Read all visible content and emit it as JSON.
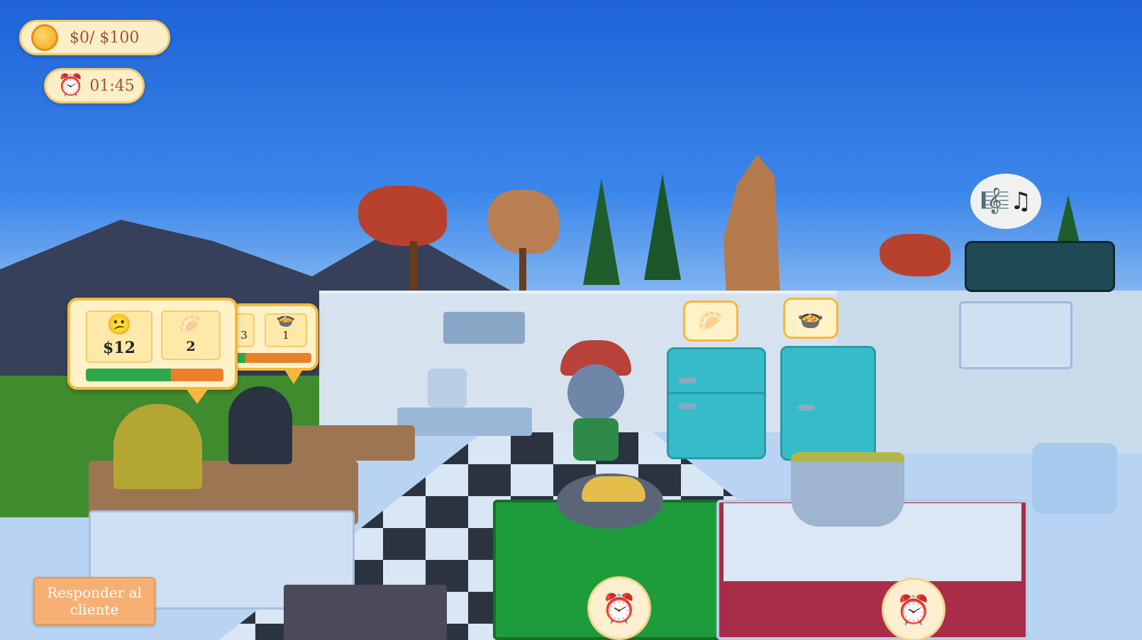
{
  "hud": {
    "money_label": "$0/ $100",
    "timer_label": "01:45"
  },
  "orders": {
    "front": {
      "tip_label": "$12",
      "item_count": "2",
      "patience_fraction": 0.62,
      "patience_colors": [
        "#2fa84a",
        "#e8812a"
      ]
    },
    "back": {
      "item_a_count": "3",
      "item_b_count": "1"
    }
  },
  "icons": {
    "coin": "coin-icon",
    "clock": "⏰",
    "customer_face": "😕",
    "empanada": "🥟",
    "soup_pot": "🍲",
    "music": "🎼♫"
  },
  "buttons": {
    "respond_label": "Responder al cliente"
  },
  "colors": {
    "hud_fill": "#fcefc7",
    "hud_border": "#f3c96a",
    "accent_text": "#a0522d",
    "button": "#f7b074"
  }
}
